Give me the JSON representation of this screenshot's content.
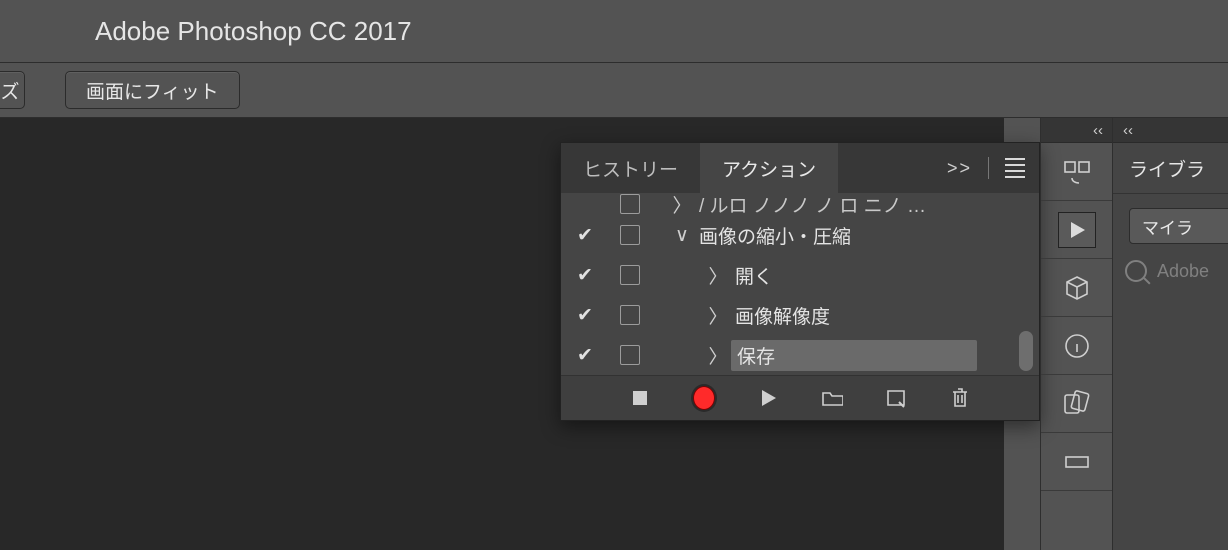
{
  "title": "Adobe Photoshop CC 2017",
  "options": {
    "left_fragment": "ズ",
    "fit_label": "画面にフィット"
  },
  "panel": {
    "tabs": {
      "history": "ヒストリー",
      "actions": "アクション"
    },
    "more": ">>",
    "rows": {
      "frag": "/   ルロ ノノノ ノ ロ   ニノ   …",
      "group": "画像の縮小・圧縮",
      "step1": "開く",
      "step2": "画像解像度",
      "step3": "保存"
    }
  },
  "side": {
    "tab": "ライブラ",
    "my": "マイラ",
    "search_placeholder": "Adobe"
  }
}
